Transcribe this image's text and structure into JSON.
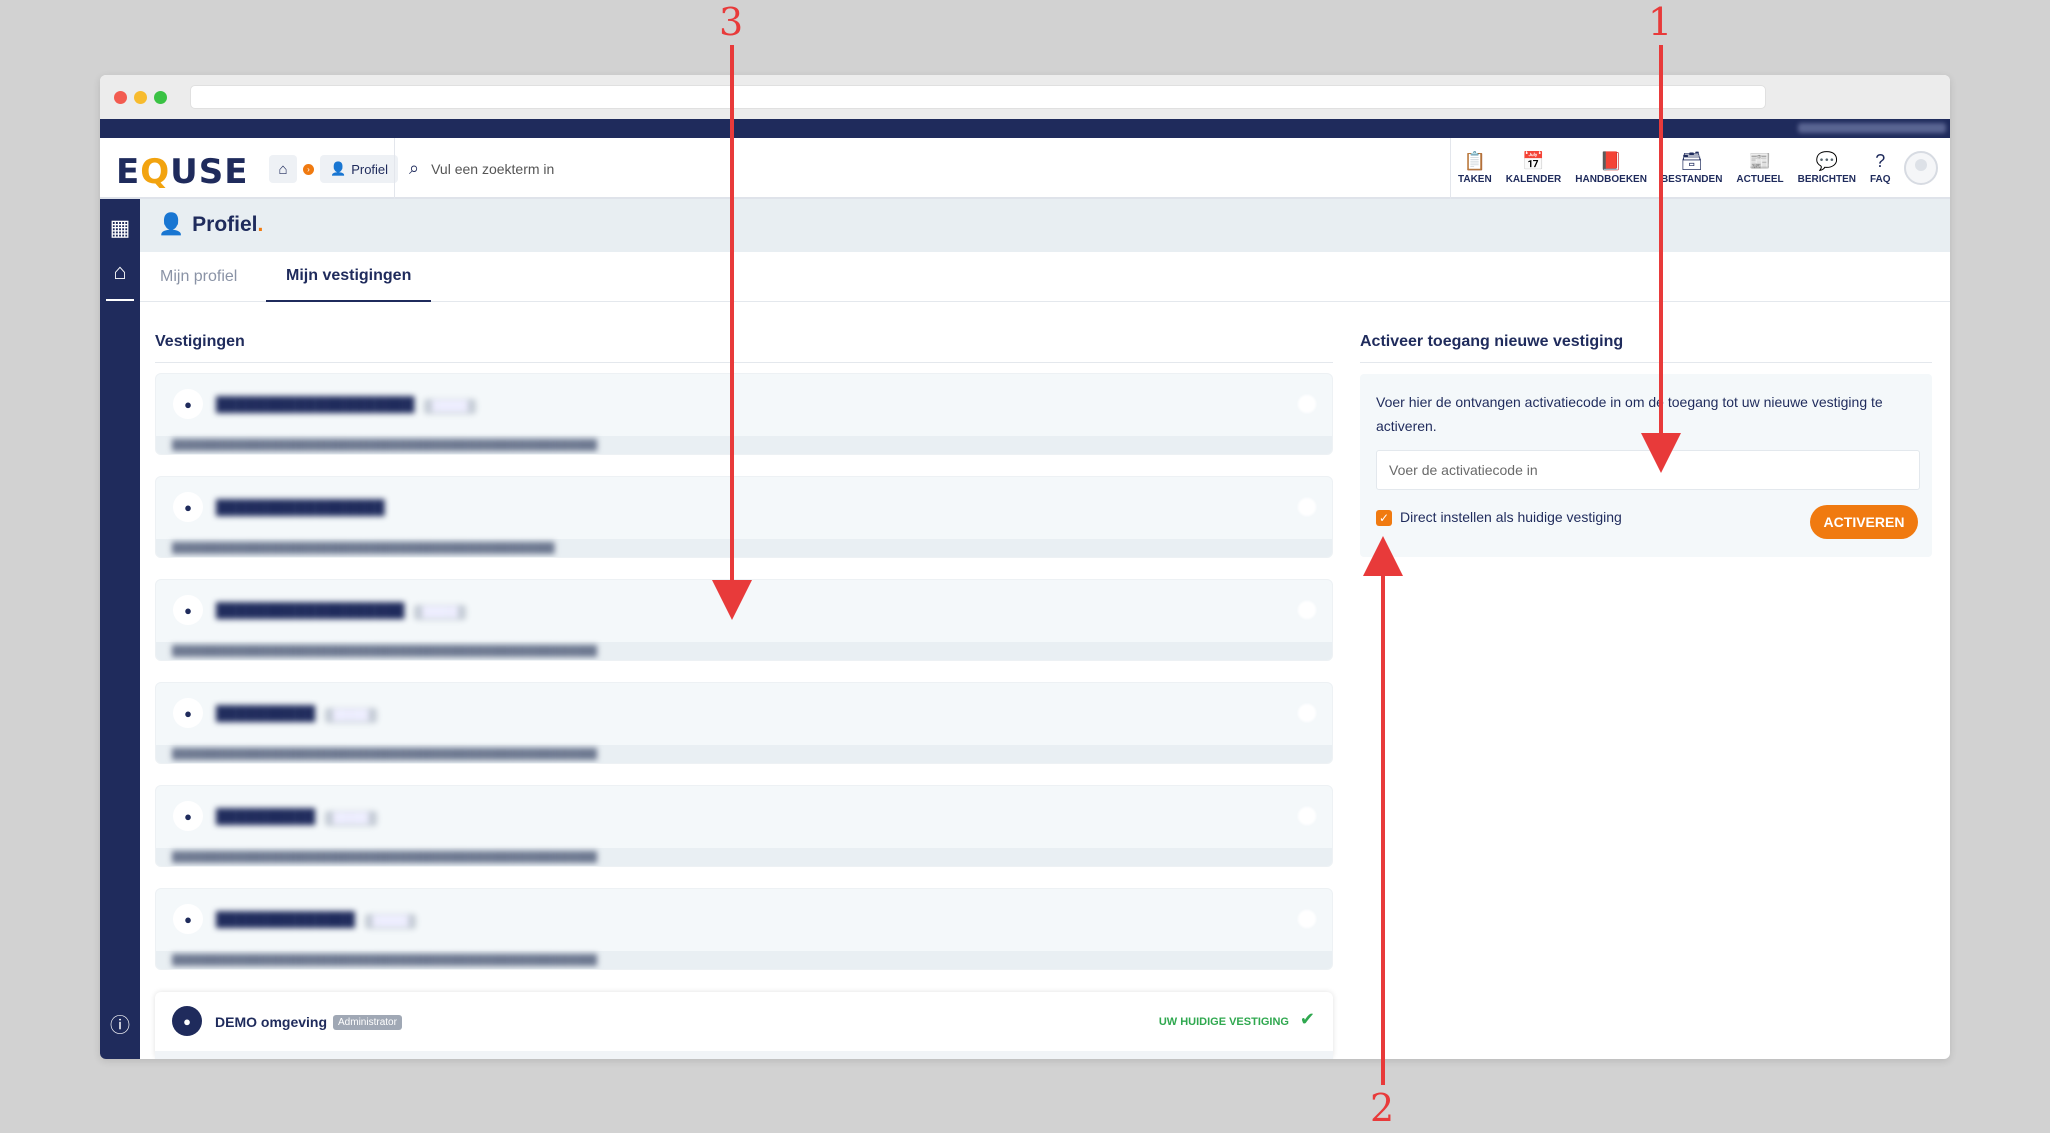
{
  "header": {
    "logo": {
      "pre": "E",
      "q": "Q",
      "post": "USE"
    },
    "breadcrumb": {
      "profile_label": "Profiel"
    },
    "search": {
      "placeholder": "Vul een zoekterm in"
    },
    "nav": [
      {
        "label": "TAKEN",
        "icon": "clipboard-icon",
        "glyph": "📋"
      },
      {
        "label": "KALENDER",
        "icon": "calendar-icon",
        "glyph": "📅"
      },
      {
        "label": "HANDBOEKEN",
        "icon": "book-icon",
        "glyph": "📕"
      },
      {
        "label": "BESTANDEN",
        "icon": "archive-icon",
        "glyph": "🗃"
      },
      {
        "label": "ACTUEEL",
        "icon": "news-icon",
        "glyph": "📰"
      },
      {
        "label": "BERICHTEN",
        "icon": "chat-icon",
        "glyph": "💬"
      },
      {
        "label": "FAQ",
        "icon": "question-icon",
        "glyph": "?"
      }
    ]
  },
  "page": {
    "title": "Profiel",
    "title_suffix": ".",
    "tabs": [
      {
        "label": "Mijn profiel",
        "active": false
      },
      {
        "label": "Mijn vestigingen",
        "active": true
      }
    ]
  },
  "vestigingen": {
    "title": "Vestigingen",
    "current": {
      "name": "DEMO omgeving",
      "role": "Administrator",
      "status": "UW HUIDIGE VESTIGING",
      "status_color": "#2fa84f"
    }
  },
  "activation": {
    "title": "Activeer toegang nieuwe vestiging",
    "description": "Voer hier de ontvangen activatiecode in om de toegang tot uw nieuwe vestiging te activeren.",
    "code_placeholder": "Voer de activatiecode in",
    "checkbox_label": "Direct instellen als huidige vestiging",
    "checkbox_checked": true,
    "button_label": "ACTIVEREN"
  },
  "annotations": {
    "one": "1",
    "two": "2",
    "three": "3"
  },
  "colors": {
    "navy": "#1f2b5c",
    "accent": "#f07a10",
    "annotation": "#e83a3a"
  }
}
